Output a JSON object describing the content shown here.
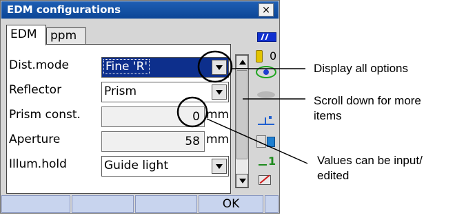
{
  "window": {
    "title": "EDM configurations",
    "close_symbol": "×"
  },
  "tabs": [
    {
      "label": "EDM"
    },
    {
      "label": "ppm"
    }
  ],
  "fields": {
    "dist_mode": {
      "label": "Dist.mode",
      "value": "Fine 'R'"
    },
    "reflector": {
      "label": "Reflector",
      "value": "Prism"
    },
    "prism_const": {
      "label": "Prism const.",
      "value": "0",
      "unit": "mm"
    },
    "aperture": {
      "label": "Aperture",
      "value": "58",
      "unit": "mm"
    },
    "illum_hold": {
      "label": "Illum.hold",
      "value": "Guide light"
    }
  },
  "status": {
    "counter": "0",
    "memory": "1"
  },
  "softkeys": {
    "ok_label": "OK"
  },
  "callouts": {
    "display_options": "Display all options",
    "scroll_down_line1": "Scroll down for more",
    "scroll_down_line2": "items",
    "values_edit_line1": "Values can be input/",
    "values_edit_line2": "edited"
  },
  "colors": {
    "title_bar": "#1a55a8",
    "selected_field": "#0d2f8c",
    "softkey": "#c8d4ee"
  }
}
